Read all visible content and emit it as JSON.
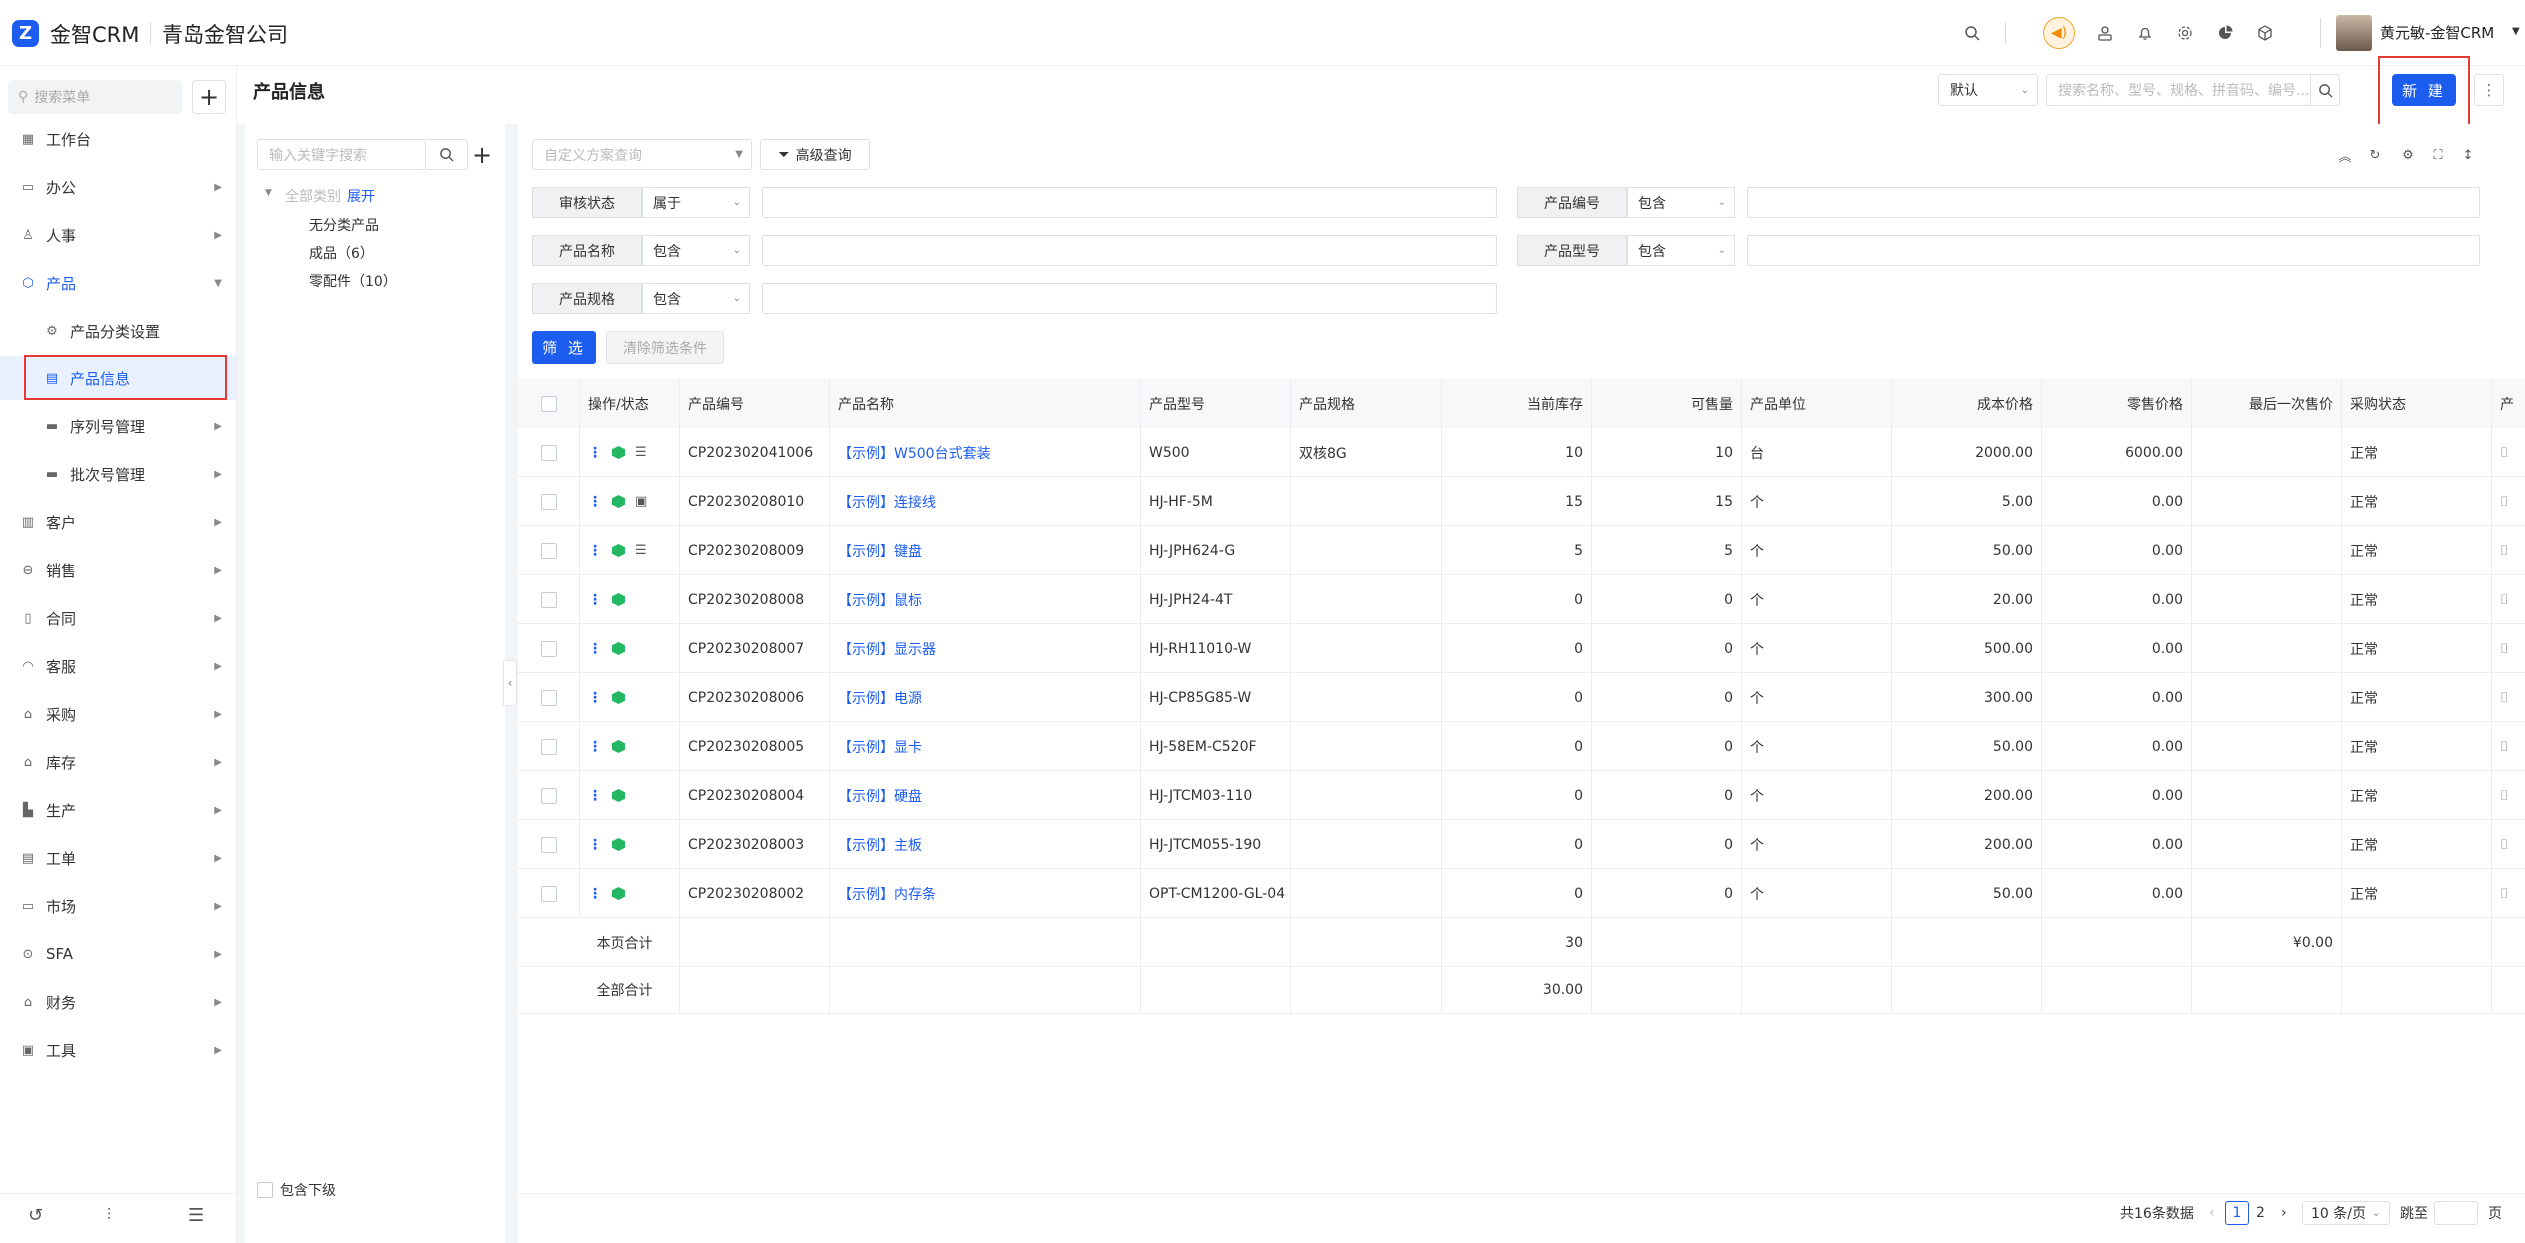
{
  "header": {
    "logo_text": "金智CRM",
    "company": "青岛金智公司",
    "user": "黄元敏-金智CRM"
  },
  "sidebar": {
    "search_placeholder": "搜索菜单",
    "items": [
      {
        "label": "工作台",
        "icon": "dashboard-icon"
      },
      {
        "label": "办公",
        "icon": "office-icon"
      },
      {
        "label": "人事",
        "icon": "people-icon"
      },
      {
        "label": "产品",
        "icon": "cube-icon"
      },
      {
        "label": "产品分类设置",
        "icon": "gear-icon"
      },
      {
        "label": "产品信息",
        "icon": "doc-icon"
      },
      {
        "label": "序列号管理",
        "icon": "folder-icon"
      },
      {
        "label": "批次号管理",
        "icon": "folder-icon"
      },
      {
        "label": "客户",
        "icon": "chart-icon"
      },
      {
        "label": "销售",
        "icon": "sales-icon"
      },
      {
        "label": "合同",
        "icon": "contract-icon"
      },
      {
        "label": "客服",
        "icon": "headset-icon"
      },
      {
        "label": "采购",
        "icon": "cart-icon"
      },
      {
        "label": "库存",
        "icon": "warehouse-icon"
      },
      {
        "label": "生产",
        "icon": "factory-icon"
      },
      {
        "label": "工单",
        "icon": "ticket-icon"
      },
      {
        "label": "市场",
        "icon": "market-icon"
      },
      {
        "label": "SFA",
        "icon": "sfa-icon"
      },
      {
        "label": "财务",
        "icon": "bank-icon"
      },
      {
        "label": "工具",
        "icon": "toolbox-icon"
      }
    ]
  },
  "page": {
    "title": "产品信息",
    "view_select": "默认",
    "search_placeholder": "搜索名称、型号、规格、拼音码、编号...",
    "new_label": "新 建"
  },
  "tree": {
    "search_placeholder": "输入关键字搜索",
    "root_label": "全部类别",
    "expand_label": "展开",
    "nodes": [
      "无分类产品",
      "成品（6）",
      "零配件（10）"
    ],
    "include_sub": "包含下级"
  },
  "filters": {
    "scheme_placeholder": "自定义方案查询",
    "advanced_label": "高级查询",
    "fields": [
      {
        "label": "审核状态",
        "op": "属于"
      },
      {
        "label": "产品编号",
        "op": "包含"
      },
      {
        "label": "产品名称",
        "op": "包含"
      },
      {
        "label": "产品型号",
        "op": "包含"
      },
      {
        "label": "产品规格",
        "op": "包含"
      }
    ],
    "filter_label": "筛 选",
    "clear_label": "清除筛选条件"
  },
  "table": {
    "headers": [
      "操作/状态",
      "产品编号",
      "产品名称",
      "产品型号",
      "产品规格",
      "当前库存",
      "可售量",
      "产品单位",
      "成本价格",
      "零售价格",
      "最后一次售价",
      "采购状态",
      "产"
    ],
    "rows": [
      {
        "code": "CP202302041006",
        "name": "【示例】W500台式套装",
        "model": "W500",
        "spec": "双核8G",
        "stock": "10",
        "avail": "10",
        "unit": "台",
        "cost": "2000.00",
        "retail": "6000.00",
        "last": "",
        "status": "正常"
      },
      {
        "code": "CP20230208010",
        "name": "【示例】连接线",
        "model": "HJ-HF-5M",
        "spec": "",
        "stock": "15",
        "avail": "15",
        "unit": "个",
        "cost": "5.00",
        "retail": "0.00",
        "last": "",
        "status": "正常"
      },
      {
        "code": "CP20230208009",
        "name": "【示例】键盘",
        "model": "HJ-JPH624-G",
        "spec": "",
        "stock": "5",
        "avail": "5",
        "unit": "个",
        "cost": "50.00",
        "retail": "0.00",
        "last": "",
        "status": "正常"
      },
      {
        "code": "CP20230208008",
        "name": "【示例】鼠标",
        "model": "HJ-JPH24-4T",
        "spec": "",
        "stock": "0",
        "avail": "0",
        "unit": "个",
        "cost": "20.00",
        "retail": "0.00",
        "last": "",
        "status": "正常"
      },
      {
        "code": "CP20230208007",
        "name": "【示例】显示器",
        "model": "HJ-RH11010-W",
        "spec": "",
        "stock": "0",
        "avail": "0",
        "unit": "个",
        "cost": "500.00",
        "retail": "0.00",
        "last": "",
        "status": "正常"
      },
      {
        "code": "CP20230208006",
        "name": "【示例】电源",
        "model": "HJ-CP85G85-W",
        "spec": "",
        "stock": "0",
        "avail": "0",
        "unit": "个",
        "cost": "300.00",
        "retail": "0.00",
        "last": "",
        "status": "正常"
      },
      {
        "code": "CP20230208005",
        "name": "【示例】显卡",
        "model": "HJ-58EM-C520F",
        "spec": "",
        "stock": "0",
        "avail": "0",
        "unit": "个",
        "cost": "50.00",
        "retail": "0.00",
        "last": "",
        "status": "正常"
      },
      {
        "code": "CP20230208004",
        "name": "【示例】硬盘",
        "model": "HJ-JTCM03-110",
        "spec": "",
        "stock": "0",
        "avail": "0",
        "unit": "个",
        "cost": "200.00",
        "retail": "0.00",
        "last": "",
        "status": "正常"
      },
      {
        "code": "CP20230208003",
        "name": "【示例】主板",
        "model": "HJ-JTCM055-190",
        "spec": "",
        "stock": "0",
        "avail": "0",
        "unit": "个",
        "cost": "200.00",
        "retail": "0.00",
        "last": "",
        "status": "正常"
      },
      {
        "code": "CP20230208002",
        "name": "【示例】内存条",
        "model": "OPT-CM1200-GL-04",
        "spec": "",
        "stock": "0",
        "avail": "0",
        "unit": "个",
        "cost": "50.00",
        "retail": "0.00",
        "last": "",
        "status": "正常"
      }
    ],
    "page_total_label": "本页合计",
    "page_total_stock": "30",
    "page_total_last": "¥0.00",
    "all_total_label": "全部合计",
    "all_total_stock": "30.00"
  },
  "pager": {
    "total": "共16条数据",
    "p1": "1",
    "p2": "2",
    "size": "10 条/页",
    "jump": "跳至",
    "page_unit": "页"
  },
  "colors": {
    "accent": "#1c5df0",
    "highlight": "#e53935",
    "ok": "#25b864"
  }
}
